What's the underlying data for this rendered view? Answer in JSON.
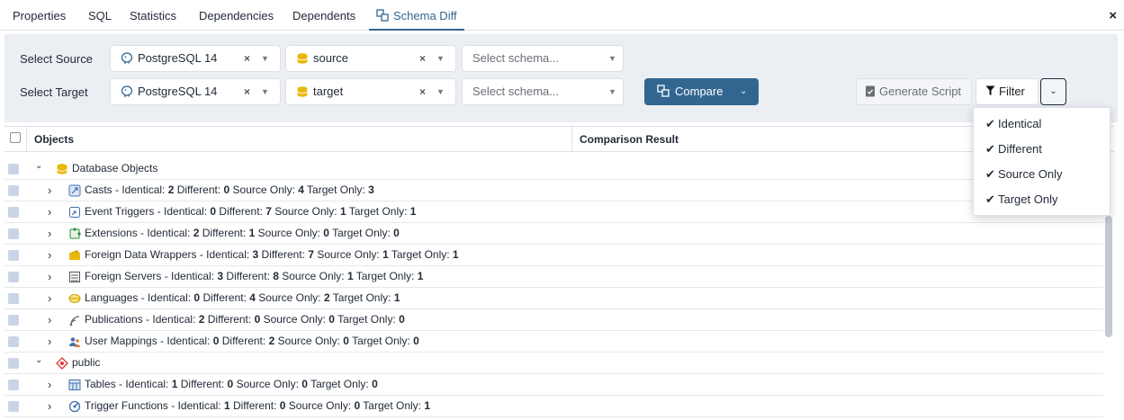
{
  "tabs": [
    {
      "label": "Properties"
    },
    {
      "label": "SQL"
    },
    {
      "label": "Statistics"
    },
    {
      "label": "Dependencies"
    },
    {
      "label": "Dependents"
    },
    {
      "label": "Schema Diff",
      "active": true
    }
  ],
  "close_label": "×",
  "selectors": {
    "source": {
      "label": "Select Source",
      "server": "PostgreSQL 14",
      "database": "source",
      "schema_placeholder": "Select schema..."
    },
    "target": {
      "label": "Select Target",
      "server": "PostgreSQL 14",
      "database": "target",
      "schema_placeholder": "Select schema..."
    },
    "clear_glyph": "×"
  },
  "toolbar": {
    "compare_label": "Compare",
    "generate_script_label": "Generate Script",
    "filter_label": "Filter"
  },
  "grid": {
    "columns": [
      "Objects",
      "Comparison Result"
    ],
    "rows": [
      {
        "level": 0,
        "icon": "database-objects-icon",
        "expanded": true,
        "name": "Database Objects"
      },
      {
        "level": 1,
        "icon": "casts-icon",
        "name": "Casts",
        "identical": "2",
        "different": "0",
        "source_only": "4",
        "target_only": "3"
      },
      {
        "level": 1,
        "icon": "event-triggers-icon",
        "name": "Event Triggers",
        "identical": "0",
        "different": "7",
        "source_only": "1",
        "target_only": "1"
      },
      {
        "level": 1,
        "icon": "extensions-icon",
        "name": "Extensions",
        "identical": "2",
        "different": "1",
        "source_only": "0",
        "target_only": "0"
      },
      {
        "level": 1,
        "icon": "foreign-data-wrappers-icon",
        "name": "Foreign Data Wrappers",
        "identical": "3",
        "different": "7",
        "source_only": "1",
        "target_only": "1"
      },
      {
        "level": 1,
        "icon": "foreign-servers-icon",
        "name": "Foreign Servers",
        "identical": "3",
        "different": "8",
        "source_only": "1",
        "target_only": "1"
      },
      {
        "level": 1,
        "icon": "languages-icon",
        "name": "Languages",
        "identical": "0",
        "different": "4",
        "source_only": "2",
        "target_only": "1"
      },
      {
        "level": 1,
        "icon": "publications-icon",
        "name": "Publications",
        "identical": "2",
        "different": "0",
        "source_only": "0",
        "target_only": "0"
      },
      {
        "level": 1,
        "icon": "user-mappings-icon",
        "name": "User Mappings",
        "identical": "0",
        "different": "2",
        "source_only": "0",
        "target_only": "0"
      },
      {
        "level": 0,
        "icon": "schema-icon",
        "expanded": true,
        "name": "public"
      },
      {
        "level": 1,
        "icon": "tables-icon",
        "name": "Tables",
        "identical": "1",
        "different": "0",
        "source_only": "0",
        "target_only": "0"
      },
      {
        "level": 1,
        "icon": "trigger-functions-icon",
        "name": "Trigger Functions",
        "identical": "1",
        "different": "0",
        "source_only": "0",
        "target_only": "1"
      }
    ],
    "stat_labels": {
      "identical": "Identical:",
      "different": "Different:",
      "source_only": "Source Only:",
      "target_only": "Target Only:"
    }
  },
  "filter_menu": {
    "items": [
      {
        "label": "Identical",
        "checked": true
      },
      {
        "label": "Different",
        "checked": true
      },
      {
        "label": "Source Only",
        "checked": true
      },
      {
        "label": "Target Only",
        "checked": true
      }
    ]
  },
  "colors": {
    "accent": "#326690",
    "panel_bg": "#ebeef3",
    "row_checkbox": "#c9d4e6"
  }
}
